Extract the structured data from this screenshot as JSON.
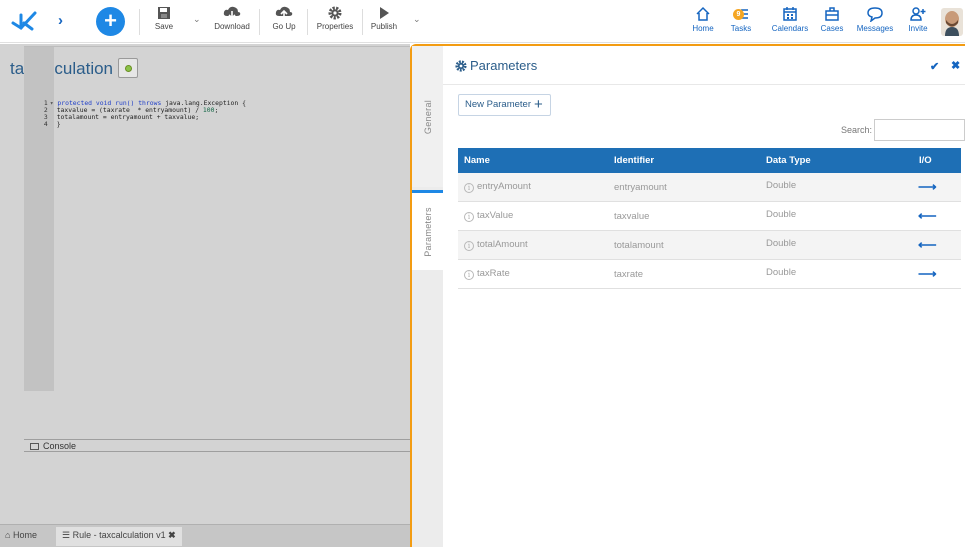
{
  "toolbar": {
    "save_label": "Save",
    "download_label": "Download",
    "goup_label": "Go Up",
    "properties_label": "Properties",
    "publish_label": "Publish"
  },
  "nav": {
    "home_label": "Home",
    "tasks_label": "Tasks",
    "tasks_badge": "9",
    "calendars_label": "Calendars",
    "cases_label": "Cases",
    "messages_label": "Messages",
    "invite_label": "Invite"
  },
  "editor": {
    "rule_name": "taxcalculation",
    "lines": [
      {
        "num": "1",
        "pre": "protected void run() throws ",
        "post": "java.lang.Exception {"
      },
      {
        "num": "2",
        "text": "taxvalue = (taxrate  * entryamount) / ",
        "num_lit": "100",
        "tail": ";"
      },
      {
        "num": "3",
        "text": "totalamount = entryamount + taxvalue;"
      },
      {
        "num": "4",
        "text": "}"
      }
    ],
    "console_label": "Console"
  },
  "bottom_tabs": {
    "home": "Home",
    "rule": "Rule - taxcalculation v1"
  },
  "panel": {
    "title": "Parameters",
    "vtab_general": "General",
    "vtab_parameters": "Parameters",
    "new_param_label": "New Parameter",
    "search_label": "Search:",
    "columns": [
      "Name",
      "Identifier",
      "Data Type",
      "I/O"
    ],
    "rows": [
      {
        "name": "entryAmount",
        "identifier": "entryamount",
        "type": "Double",
        "io": "in"
      },
      {
        "name": "taxValue",
        "identifier": "taxvalue",
        "type": "Double",
        "io": "out"
      },
      {
        "name": "totalAmount",
        "identifier": "totalamount",
        "type": "Double",
        "io": "out"
      },
      {
        "name": "taxRate",
        "identifier": "taxrate",
        "type": "Double",
        "io": "in"
      }
    ]
  },
  "colors": {
    "accent": "#1e88e5",
    "panel_border": "#f39c12",
    "header_blue": "#1e6fb5"
  }
}
